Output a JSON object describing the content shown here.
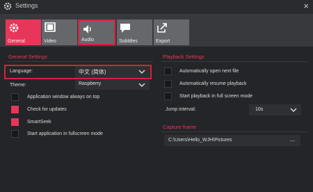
{
  "window": {
    "title": "Settings"
  },
  "tabs": [
    {
      "label": "General",
      "icon": "gear-icon",
      "active": true
    },
    {
      "label": "Video",
      "icon": "film-icon"
    },
    {
      "label": "Audio",
      "icon": "speaker-icon",
      "highlighted": true
    },
    {
      "label": "Subtitles",
      "icon": "speech-bubble-icon"
    },
    {
      "label": "Export",
      "icon": "export-icon"
    }
  ],
  "general": {
    "title": "General Settings",
    "language_label": "Language:",
    "language_value": "中文 (简体)",
    "theme_label": "Theme:",
    "theme_value": "Raspberry",
    "options": [
      {
        "label": "Application window always on top",
        "checked": false
      },
      {
        "label": "Check for updates",
        "checked": true
      },
      {
        "label": "SmartSeek",
        "checked": true
      },
      {
        "label": "Start application in fullscreen mode",
        "checked": false
      }
    ]
  },
  "playback": {
    "title": "Playback Settings",
    "options": [
      {
        "label": "Automatically open next file",
        "checked": false
      },
      {
        "label": "Automatically resume playback",
        "checked": false
      },
      {
        "label": "Start playback in full screen mode",
        "checked": false
      }
    ],
    "jump_label": "Jump interval:",
    "jump_value": "10s"
  },
  "capture": {
    "title": "Capture frame",
    "path": "C:\\Users\\Hello_WJH\\Pictures",
    "browse_label": "..."
  },
  "colors": {
    "accent": "#e8365a",
    "highlight": "#d9223e"
  }
}
